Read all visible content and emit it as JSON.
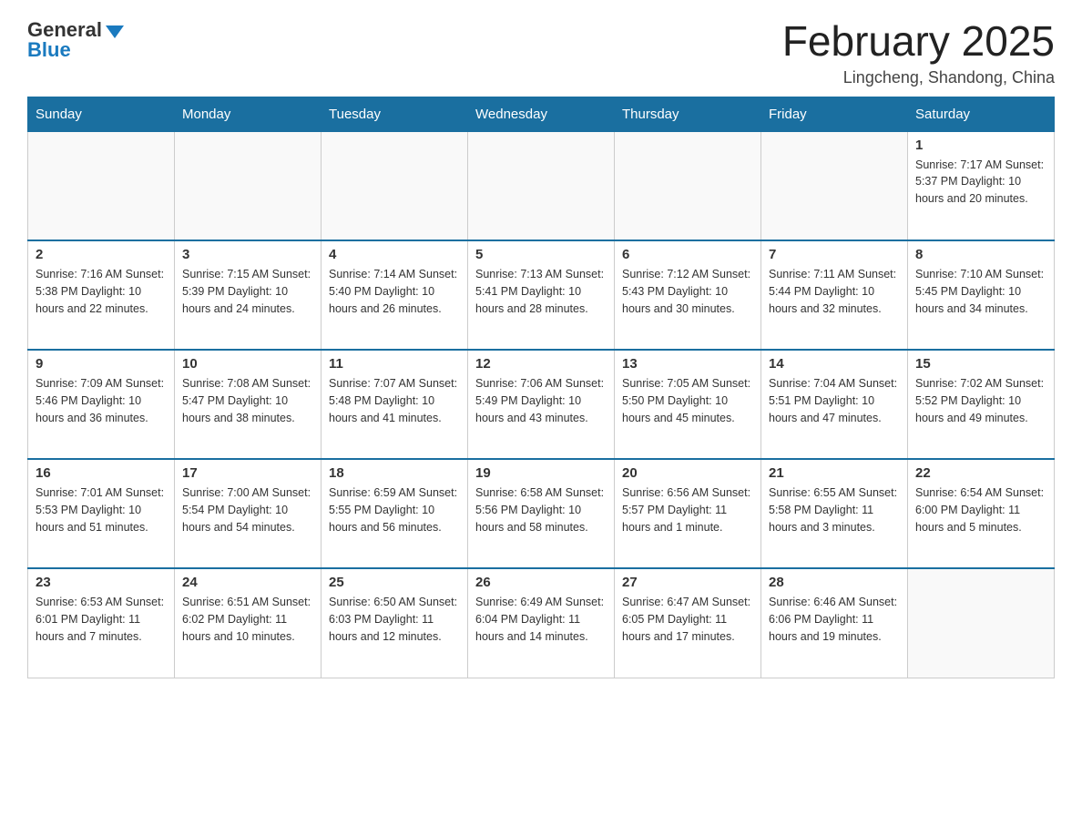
{
  "header": {
    "logo_general": "General",
    "logo_blue": "Blue",
    "month_title": "February 2025",
    "location": "Lingcheng, Shandong, China"
  },
  "days_of_week": [
    "Sunday",
    "Monday",
    "Tuesday",
    "Wednesday",
    "Thursday",
    "Friday",
    "Saturday"
  ],
  "weeks": [
    [
      {
        "day": "",
        "info": ""
      },
      {
        "day": "",
        "info": ""
      },
      {
        "day": "",
        "info": ""
      },
      {
        "day": "",
        "info": ""
      },
      {
        "day": "",
        "info": ""
      },
      {
        "day": "",
        "info": ""
      },
      {
        "day": "1",
        "info": "Sunrise: 7:17 AM\nSunset: 5:37 PM\nDaylight: 10 hours and 20 minutes."
      }
    ],
    [
      {
        "day": "2",
        "info": "Sunrise: 7:16 AM\nSunset: 5:38 PM\nDaylight: 10 hours and 22 minutes."
      },
      {
        "day": "3",
        "info": "Sunrise: 7:15 AM\nSunset: 5:39 PM\nDaylight: 10 hours and 24 minutes."
      },
      {
        "day": "4",
        "info": "Sunrise: 7:14 AM\nSunset: 5:40 PM\nDaylight: 10 hours and 26 minutes."
      },
      {
        "day": "5",
        "info": "Sunrise: 7:13 AM\nSunset: 5:41 PM\nDaylight: 10 hours and 28 minutes."
      },
      {
        "day": "6",
        "info": "Sunrise: 7:12 AM\nSunset: 5:43 PM\nDaylight: 10 hours and 30 minutes."
      },
      {
        "day": "7",
        "info": "Sunrise: 7:11 AM\nSunset: 5:44 PM\nDaylight: 10 hours and 32 minutes."
      },
      {
        "day": "8",
        "info": "Sunrise: 7:10 AM\nSunset: 5:45 PM\nDaylight: 10 hours and 34 minutes."
      }
    ],
    [
      {
        "day": "9",
        "info": "Sunrise: 7:09 AM\nSunset: 5:46 PM\nDaylight: 10 hours and 36 minutes."
      },
      {
        "day": "10",
        "info": "Sunrise: 7:08 AM\nSunset: 5:47 PM\nDaylight: 10 hours and 38 minutes."
      },
      {
        "day": "11",
        "info": "Sunrise: 7:07 AM\nSunset: 5:48 PM\nDaylight: 10 hours and 41 minutes."
      },
      {
        "day": "12",
        "info": "Sunrise: 7:06 AM\nSunset: 5:49 PM\nDaylight: 10 hours and 43 minutes."
      },
      {
        "day": "13",
        "info": "Sunrise: 7:05 AM\nSunset: 5:50 PM\nDaylight: 10 hours and 45 minutes."
      },
      {
        "day": "14",
        "info": "Sunrise: 7:04 AM\nSunset: 5:51 PM\nDaylight: 10 hours and 47 minutes."
      },
      {
        "day": "15",
        "info": "Sunrise: 7:02 AM\nSunset: 5:52 PM\nDaylight: 10 hours and 49 minutes."
      }
    ],
    [
      {
        "day": "16",
        "info": "Sunrise: 7:01 AM\nSunset: 5:53 PM\nDaylight: 10 hours and 51 minutes."
      },
      {
        "day": "17",
        "info": "Sunrise: 7:00 AM\nSunset: 5:54 PM\nDaylight: 10 hours and 54 minutes."
      },
      {
        "day": "18",
        "info": "Sunrise: 6:59 AM\nSunset: 5:55 PM\nDaylight: 10 hours and 56 minutes."
      },
      {
        "day": "19",
        "info": "Sunrise: 6:58 AM\nSunset: 5:56 PM\nDaylight: 10 hours and 58 minutes."
      },
      {
        "day": "20",
        "info": "Sunrise: 6:56 AM\nSunset: 5:57 PM\nDaylight: 11 hours and 1 minute."
      },
      {
        "day": "21",
        "info": "Sunrise: 6:55 AM\nSunset: 5:58 PM\nDaylight: 11 hours and 3 minutes."
      },
      {
        "day": "22",
        "info": "Sunrise: 6:54 AM\nSunset: 6:00 PM\nDaylight: 11 hours and 5 minutes."
      }
    ],
    [
      {
        "day": "23",
        "info": "Sunrise: 6:53 AM\nSunset: 6:01 PM\nDaylight: 11 hours and 7 minutes."
      },
      {
        "day": "24",
        "info": "Sunrise: 6:51 AM\nSunset: 6:02 PM\nDaylight: 11 hours and 10 minutes."
      },
      {
        "day": "25",
        "info": "Sunrise: 6:50 AM\nSunset: 6:03 PM\nDaylight: 11 hours and 12 minutes."
      },
      {
        "day": "26",
        "info": "Sunrise: 6:49 AM\nSunset: 6:04 PM\nDaylight: 11 hours and 14 minutes."
      },
      {
        "day": "27",
        "info": "Sunrise: 6:47 AM\nSunset: 6:05 PM\nDaylight: 11 hours and 17 minutes."
      },
      {
        "day": "28",
        "info": "Sunrise: 6:46 AM\nSunset: 6:06 PM\nDaylight: 11 hours and 19 minutes."
      },
      {
        "day": "",
        "info": ""
      }
    ]
  ]
}
